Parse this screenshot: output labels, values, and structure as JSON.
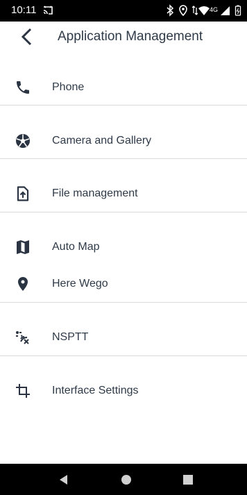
{
  "status_bar": {
    "time": "10:11",
    "network": "4G",
    "icons": [
      "cast-icon",
      "bluetooth-icon",
      "location-icon",
      "data-arrows-icon",
      "wifi-icon",
      "cellular-icon",
      "battery-icon"
    ]
  },
  "header": {
    "title": "Application Management",
    "back_icon": "chevron-left-icon"
  },
  "menu": {
    "items": [
      {
        "label": "Phone",
        "icon": "phone-icon"
      },
      {
        "label": "Camera and Gallery",
        "icon": "aperture-icon"
      },
      {
        "label": "File management",
        "icon": "file-upload-icon"
      },
      {
        "label": "Auto Map",
        "icon": "map-icon"
      },
      {
        "label": "Here Wego",
        "icon": "location-pin-icon"
      },
      {
        "label": "NSPTT",
        "icon": "radio-signal-icon"
      },
      {
        "label": "Interface Settings",
        "icon": "crop-icon"
      }
    ]
  },
  "nav_bar": {
    "icons": [
      "back-triangle-icon",
      "home-circle-icon",
      "recents-square-icon"
    ]
  },
  "colors": {
    "text": "#2f3a48",
    "icon": "#2a3442",
    "divider": "#d9d9d9",
    "bars": "#000000"
  }
}
